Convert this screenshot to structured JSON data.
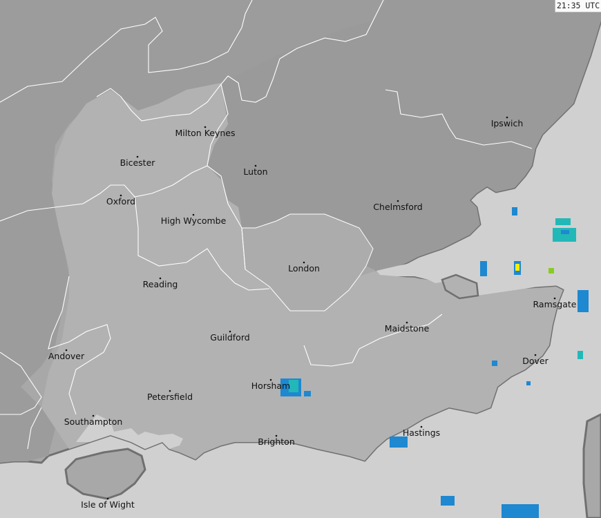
{
  "timestamp": "21:35 UTC",
  "colors": {
    "sea": "#d0d0d0",
    "land_dark": "#9a9a9a",
    "land_mid": "#a8a8a8",
    "land_light": "#b6b6b6",
    "coast": "#6f6f6f",
    "boundary": "#ffffff",
    "rain_light": "#1e88d0",
    "rain_moderate": "#22b8b8",
    "rain_heavy": "#ffee00"
  },
  "places": [
    {
      "name": "Milton Keynes"
    },
    {
      "name": "Bicester"
    },
    {
      "name": "Luton"
    },
    {
      "name": "Ipswich"
    },
    {
      "name": "Oxford"
    },
    {
      "name": "Chelmsford"
    },
    {
      "name": "High Wycombe"
    },
    {
      "name": "London"
    },
    {
      "name": "Reading"
    },
    {
      "name": "Ramsgate"
    },
    {
      "name": "Maidstone"
    },
    {
      "name": "Guildford"
    },
    {
      "name": "Andover"
    },
    {
      "name": "Dover"
    },
    {
      "name": "Horsham"
    },
    {
      "name": "Petersfield"
    },
    {
      "name": "Southampton"
    },
    {
      "name": "Hastings"
    },
    {
      "name": "Brighton"
    },
    {
      "name": "Isle of Wight"
    }
  ]
}
